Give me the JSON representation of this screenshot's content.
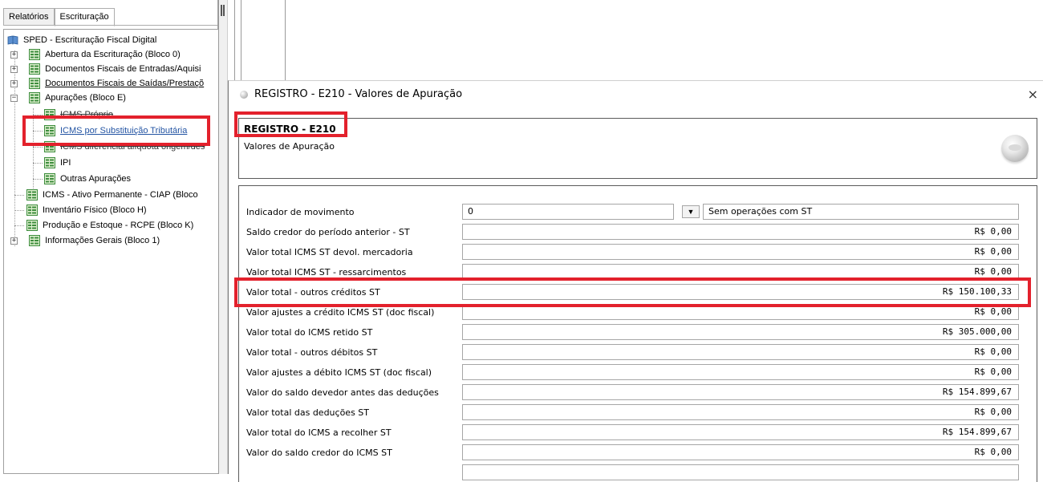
{
  "left_panel": {
    "tabs": [
      {
        "label": "Relatórios",
        "active": false
      },
      {
        "label": "Escrituração",
        "active": true
      }
    ],
    "tree": {
      "root": "SPED - Escrituração Fiscal Digital",
      "items": [
        {
          "label": "Abertura da Escrituração (Bloco 0)",
          "expander": "+"
        },
        {
          "label": "Documentos Fiscais de Entradas/Aquisi",
          "expander": "+"
        },
        {
          "label": "Documentos Fiscais de Saídas/Prestaçõ",
          "expander": "+"
        },
        {
          "label": "Apurações (Bloco E)",
          "expander": "−"
        },
        {
          "label": "ICMS Próprio"
        },
        {
          "label": "ICMS por Substituição Tributária"
        },
        {
          "label": "ICMS diferencial alíquota origem/des"
        },
        {
          "label": "IPI"
        },
        {
          "label": "Outras Apurações"
        },
        {
          "label": "ICMS - Ativo Permanente - CIAP (Bloco"
        },
        {
          "label": "Inventário Físico (Bloco H)"
        },
        {
          "label": "Produção e Estoque - RCPE (Bloco K)"
        },
        {
          "label": "Informações Gerais (Bloco 1)",
          "expander": "+"
        }
      ]
    }
  },
  "dialog": {
    "title": "REGISTRO - E210 - Valores de Apuração",
    "close_icon": "×",
    "header": {
      "code": "REGISTRO - E210",
      "description": "Valores de Apuração"
    },
    "form": {
      "indicator": {
        "label": "Indicador de movimento",
        "code": "0",
        "dropdown_icon": "▼",
        "description": "Sem operações com ST"
      },
      "rows": [
        {
          "label": "Saldo credor do período anterior - ST",
          "value": "R$ 0,00"
        },
        {
          "label": "Valor total ICMS ST devol. mercadoria",
          "value": "R$ 0,00"
        },
        {
          "label": "Valor total ICMS ST - ressarcimentos",
          "value": "R$ 0,00"
        },
        {
          "label": "Valor total - outros créditos ST",
          "value": "R$ 150.100,33"
        },
        {
          "label": "Valor ajustes a crédito ICMS ST (doc fiscal)",
          "value": "R$ 0,00"
        },
        {
          "label": "Valor total do ICMS retido ST",
          "value": "R$ 305.000,00"
        },
        {
          "label": "Valor total - outros débitos ST",
          "value": "R$ 0,00"
        },
        {
          "label": "Valor ajustes a débito ICMS ST (doc fiscal)",
          "value": "R$ 0,00"
        },
        {
          "label": "Valor do saldo devedor antes das deduções",
          "value": "R$ 154.899,67"
        },
        {
          "label": "Valor total das deduções ST",
          "value": "R$ 0,00"
        },
        {
          "label": "Valor total do ICMS a recolher ST",
          "value": "R$ 154.899,67"
        },
        {
          "label": "Valor do saldo credor do ICMS ST",
          "value": "R$ 0,00"
        }
      ]
    }
  },
  "colors": {
    "highlight": "#e3212c",
    "link": "#2354a3",
    "tree_icon": "#3c8c3c"
  }
}
